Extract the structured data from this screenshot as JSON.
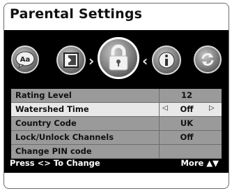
{
  "title": "Parental Settings",
  "icons": [
    "aa-icon",
    "input-icon",
    "lock-icon",
    "info-icon",
    "refresh-icon"
  ],
  "icon_text": {
    "aa": "Aa"
  },
  "arrows": {
    "left": "›",
    "right": "‹"
  },
  "menu": [
    {
      "label": "Rating Level",
      "value": "12"
    },
    {
      "label": "Watershed Time",
      "value": "Off"
    },
    {
      "label": "Country Code",
      "value": "UK"
    },
    {
      "label": "Lock/Unlock Channels",
      "value": "Off"
    },
    {
      "label": "Change PIN code",
      "value": ""
    }
  ],
  "selected_index": 1,
  "value_arrows": {
    "left": "◁",
    "right": "▷"
  },
  "footer": {
    "hint": "Press <> To Change",
    "more": "More ▲▼"
  }
}
